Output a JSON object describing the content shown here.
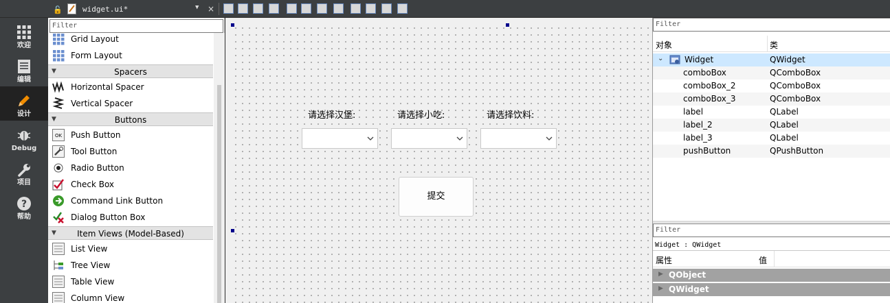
{
  "topbar": {
    "file_name": "widget.ui*",
    "close": "×",
    "dropdown": "▼"
  },
  "modes": [
    {
      "label": "欢迎",
      "icon": "grid-icon"
    },
    {
      "label": "编辑",
      "icon": "document-icon"
    },
    {
      "label": "设计",
      "icon": "pencil-icon"
    },
    {
      "label": "Debug",
      "icon": "bug-icon"
    },
    {
      "label": "项目",
      "icon": "wrench-icon"
    },
    {
      "label": "帮助",
      "icon": "help-icon"
    }
  ],
  "widget_box": {
    "filter_placeholder": "Filter",
    "items": [
      {
        "label": "Grid Layout",
        "icon": "grid-layout-icon"
      },
      {
        "label": "Form Layout",
        "icon": "form-layout-icon"
      },
      {
        "category": "Spacers"
      },
      {
        "label": "Horizontal Spacer",
        "icon": "horizontal-spacer-icon"
      },
      {
        "label": "Vertical Spacer",
        "icon": "vertical-spacer-icon"
      },
      {
        "category": "Buttons"
      },
      {
        "label": "Push Button",
        "icon": "push-button-icon",
        "icon_text": "OK"
      },
      {
        "label": "Tool Button",
        "icon": "tool-button-icon"
      },
      {
        "label": "Radio Button",
        "icon": "radio-button-icon"
      },
      {
        "label": "Check Box",
        "icon": "check-box-icon"
      },
      {
        "label": "Command Link Button",
        "icon": "command-link-icon"
      },
      {
        "label": "Dialog Button Box",
        "icon": "dialog-button-box-icon"
      },
      {
        "category": "Item Views (Model-Based)"
      },
      {
        "label": "List View",
        "icon": "list-view-icon"
      },
      {
        "label": "Tree View",
        "icon": "tree-view-icon"
      },
      {
        "label": "Table View",
        "icon": "table-view-icon"
      },
      {
        "label": "Column View",
        "icon": "column-view-icon"
      }
    ]
  },
  "form": {
    "labels": [
      "请选择汉堡:",
      "请选择小吃:",
      "请选择饮料:"
    ],
    "submit": "提交"
  },
  "object_inspector": {
    "filter_placeholder": "Filter",
    "col_object": "对象",
    "col_class": "类",
    "rows": [
      {
        "name": "Widget",
        "cls": "QWidget",
        "level": 0
      },
      {
        "name": "comboBox",
        "cls": "QComboBox",
        "level": 1
      },
      {
        "name": "comboBox_2",
        "cls": "QComboBox",
        "level": 1
      },
      {
        "name": "comboBox_3",
        "cls": "QComboBox",
        "level": 1
      },
      {
        "name": "label",
        "cls": "QLabel",
        "level": 1
      },
      {
        "name": "label_2",
        "cls": "QLabel",
        "level": 1
      },
      {
        "name": "label_3",
        "cls": "QLabel",
        "level": 1
      },
      {
        "name": "pushButton",
        "cls": "QPushButton",
        "level": 1
      }
    ]
  },
  "property_editor": {
    "filter_placeholder": "Filter",
    "info": "Widget : QWidget",
    "col_property": "属性",
    "col_value": "值",
    "groups": [
      "QObject",
      "QWidget"
    ]
  },
  "colors": {
    "mode_bar": "#3c3f41",
    "accent_active": "#f08c00",
    "selection": "#cde8ff",
    "group_header": "#a2a2a2"
  }
}
